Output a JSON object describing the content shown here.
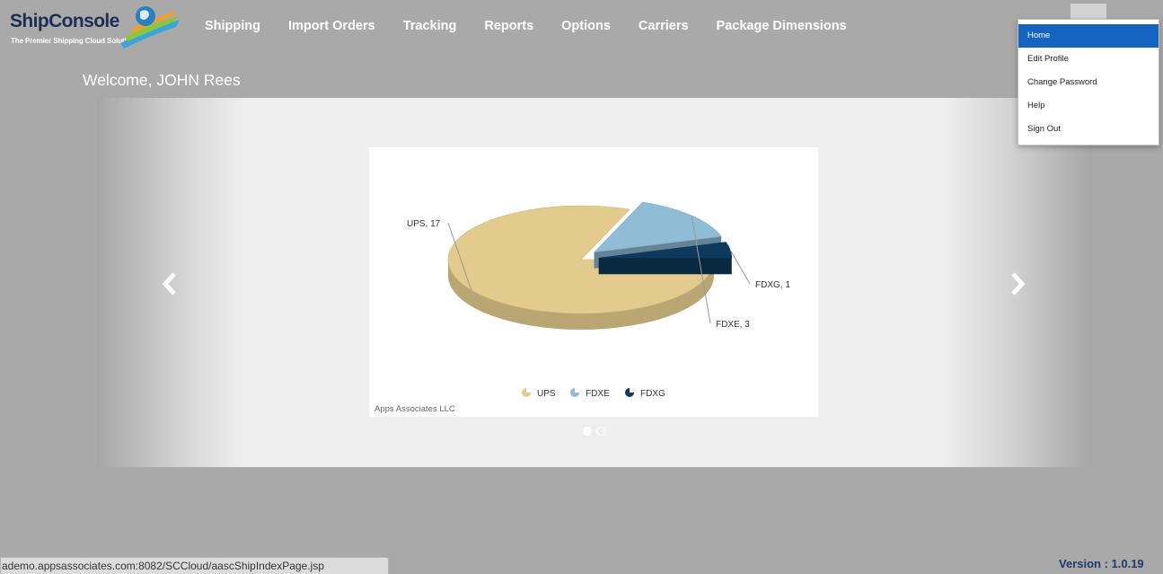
{
  "brand": {
    "name": "ShipConsole",
    "tagline": "The Premier Shipping Cloud Solution"
  },
  "nav": {
    "items": [
      {
        "label": "Shipping"
      },
      {
        "label": "Import Orders"
      },
      {
        "label": "Tracking"
      },
      {
        "label": "Reports"
      },
      {
        "label": "Options"
      },
      {
        "label": "Carriers"
      },
      {
        "label": "Package Dimensions"
      }
    ]
  },
  "welcome": "Welcome, JOHN Rees",
  "user_menu": {
    "items": [
      {
        "label": "Home",
        "active": true
      },
      {
        "label": "Edit Profile"
      },
      {
        "label": "Change Password"
      },
      {
        "label": "Help"
      },
      {
        "label": "Sign Out"
      }
    ]
  },
  "carousel": {
    "slide_count": 2,
    "active_slide": 1,
    "prev_icon": "chevron-left-icon",
    "next_icon": "chevron-right-icon"
  },
  "chart_credit": "Apps Associates LLC",
  "chart_data": {
    "type": "pie",
    "style": "3d",
    "title": "",
    "categories": [
      "UPS",
      "FDXE",
      "FDXG"
    ],
    "values": [
      17,
      3,
      1
    ],
    "data_labels": [
      "UPS, 17",
      "FDXE, 3",
      "FDXG, 1"
    ],
    "colors": [
      "#e2cb8c",
      "#8fbdd6",
      "#0d3a5c"
    ],
    "legend": {
      "placement": "bottom-center",
      "entries": [
        "UPS",
        "FDXE",
        "FDXG"
      ]
    }
  },
  "status_url": "ademo.appsassociates.com:8082/SCCloud/aascShipIndexPage.jsp",
  "version": "Version : 1.0.19",
  "colors": {
    "page_background": "#a9a9a9",
    "menu_active": "#1464c0",
    "version_text": "#1e3b6b"
  }
}
